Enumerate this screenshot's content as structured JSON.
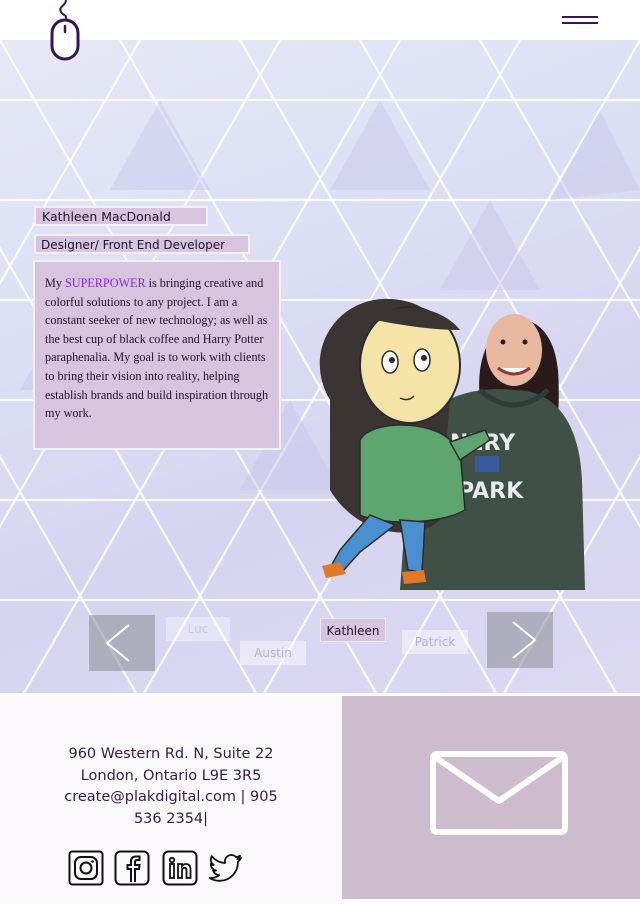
{
  "header": {
    "logo": "mouse-icon",
    "menu": "hamburger-menu-icon"
  },
  "profile": {
    "name": "Kathleen MacDonald",
    "role": "Designer/ Front End Developer",
    "bio_prefix": "My ",
    "bio_highlight": "SUPERPOWER",
    "bio_rest": " is bringing creative and colorful solutions to any project. I am a constant seeker of new  technology; as well as the best cup of black coffee and Harry Potter paraphenalia. My goal is to work with clients to bring their vision into reality, helping establish brands and build inspiration through my work.",
    "highlight_color": "#8a2bd9"
  },
  "carousel": {
    "prev_icon": "chevron-left-icon",
    "next_icon": "chevron-right-icon",
    "people": [
      "Luc",
      "Austin",
      "Kathleen",
      "Patrick"
    ],
    "active": "Kathleen"
  },
  "contact": {
    "address_line1": "960 Western Rd. N, Suite 22",
    "address_line2": "London, Ontario L9E 3R5",
    "email_phone": "create@plakdigital.com | 905",
    "phone_end": "536 2354|",
    "socials": [
      "instagram-icon",
      "facebook-icon",
      "linkedin-icon",
      "twitter-icon"
    ],
    "mail_icon": "mail-icon"
  },
  "colors": {
    "accent": "#3a1450",
    "tag_bg": "#d7c4df",
    "footer_right": "#cdbccd"
  }
}
